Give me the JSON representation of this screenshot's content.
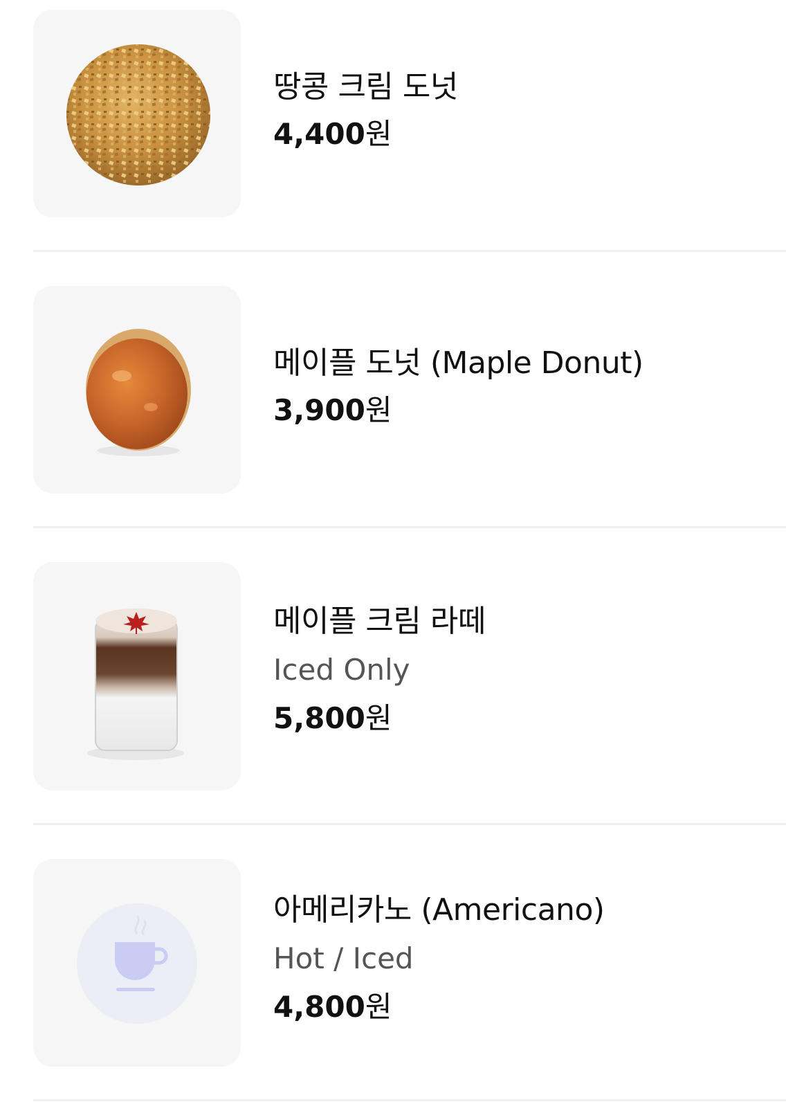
{
  "menu": {
    "items": [
      {
        "name": "땅콩 크림 도넛",
        "subtitle": "",
        "price": "4,400",
        "currency": "원",
        "image": "peanut-cream-donut-photo"
      },
      {
        "name": "메이플 도넛 (Maple Donut)",
        "subtitle": "",
        "price": "3,900",
        "currency": "원",
        "image": "maple-donut-photo"
      },
      {
        "name": "메이플 크림 라떼",
        "subtitle": "Iced Only",
        "price": "5,800",
        "currency": "원",
        "image": "maple-cream-latte-photo"
      },
      {
        "name": "아메리카노 (Americano)",
        "subtitle": "Hot / Iced",
        "price": "4,800",
        "currency": "원",
        "image": "coffee-cup-icon"
      }
    ]
  },
  "colors": {
    "thumb_bg": "#f6f6f6",
    "divider": "#f0f0f0",
    "subtitle": "#555555",
    "placeholder_circle": "#eceef5",
    "placeholder_cup": "#c9cdf4"
  }
}
